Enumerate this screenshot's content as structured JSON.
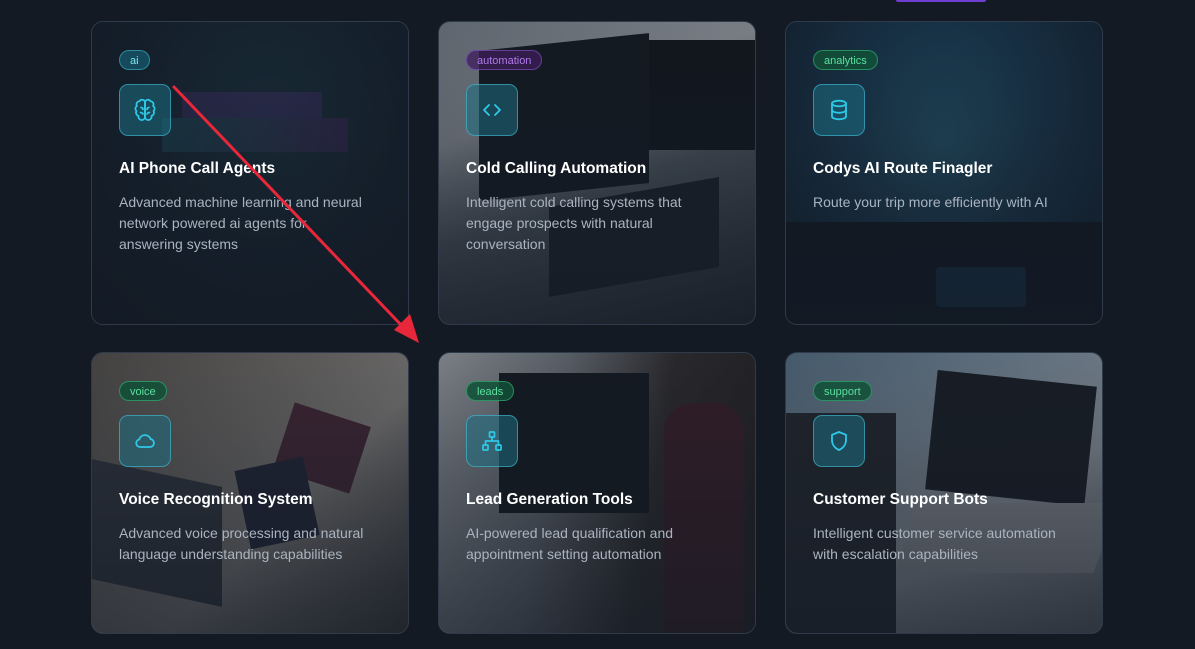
{
  "cards": [
    {
      "tag": "ai",
      "icon": "brain-icon",
      "title": "AI Phone Call Agents",
      "description": "Advanced machine learning and neural network powered ai agents for answering systems"
    },
    {
      "tag": "automation",
      "icon": "code-icon",
      "title": "Cold Calling Automation",
      "description": "Intelligent cold calling systems that engage prospects with natural conversation"
    },
    {
      "tag": "analytics",
      "icon": "database-icon",
      "title": "Codys AI Route Finagler",
      "description": "Route your trip more efficiently with AI"
    },
    {
      "tag": "voice",
      "icon": "cloud-icon",
      "title": "Voice Recognition System",
      "description": "Advanced voice processing and natural language understanding capabilities"
    },
    {
      "tag": "leads",
      "icon": "network-icon",
      "title": "Lead Generation Tools",
      "description": "AI-powered lead qualification and appointment setting automation"
    },
    {
      "tag": "support",
      "icon": "shield-icon",
      "title": "Customer Support Bots",
      "description": "Intelligent customer service automation with escalation capabilities"
    }
  ],
  "colors": {
    "background": "#131a24",
    "annotation_arrow": "#e8283a",
    "icon_accent": "#2ec9e8"
  }
}
